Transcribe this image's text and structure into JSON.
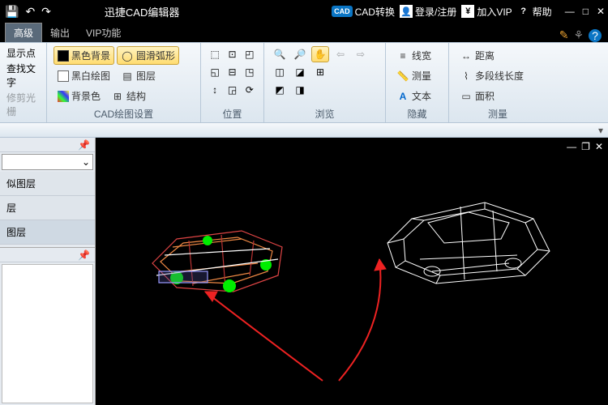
{
  "titlebar": {
    "title": "迅捷CAD编辑器",
    "cad_badge": "CAD",
    "convert": "CAD转换",
    "login": "登录/注册",
    "vip": "加入VIP",
    "help": "帮助"
  },
  "tabs": {
    "advanced": "高级",
    "output": "输出",
    "vip": "VIP功能"
  },
  "left_group": {
    "show_points": "显示点",
    "find_text": "查找文字",
    "trim_grid": "修剪光栅"
  },
  "ribbon": {
    "draw_group_label": "CAD绘图设置",
    "black_bg": "黑色背景",
    "bw_draw": "黑白绘图",
    "bg_color": "背景色",
    "smooth_arc": "圆滑弧形",
    "layer": "图层",
    "structure": "结构",
    "position_label": "位置",
    "browse_label": "浏览",
    "hide_label": "隐藏",
    "linewidth": "线宽",
    "measure": "测量",
    "text": "文本",
    "measure_label": "测量",
    "distance": "距离",
    "polyline_len": "多段线长度",
    "area": "面积"
  },
  "sidepanel": {
    "items": [
      "似图层",
      "层",
      "图层"
    ]
  }
}
